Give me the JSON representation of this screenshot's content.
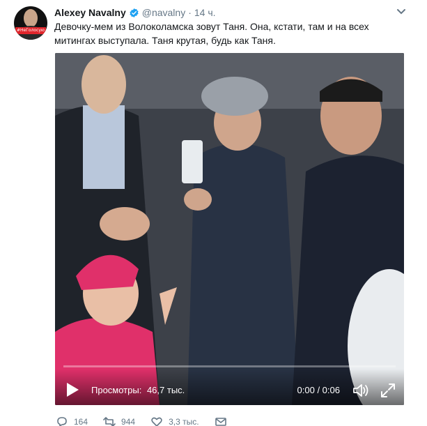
{
  "tweet": {
    "author_name": "Alexey Navalny",
    "author_handle": "@navalny",
    "separator": "·",
    "time": "14 ч.",
    "avatar_tag": "#НеГолосую",
    "text": "Девочку-мем из Волоколамска зовут Таня. Она, кстати, там и на всех митингах выступала. Таня крутая, будь как Таня."
  },
  "video": {
    "views_label": "Просмотры:",
    "views_value": "46,7 тыс.",
    "timecode": "0:00 / 0:06",
    "progress_fraction": 0
  },
  "actions": {
    "replies": "164",
    "retweets": "944",
    "likes": "3,3 тыс."
  },
  "icons": {
    "verified": "verified-badge-icon",
    "caret": "chevron-down-icon",
    "play": "play-icon",
    "volume": "volume-icon",
    "fullscreen": "fullscreen-icon",
    "reply": "reply-icon",
    "retweet": "retweet-icon",
    "like": "heart-icon",
    "message": "envelope-icon"
  },
  "colors": {
    "verified": "#1da1f2",
    "secondary_text": "#657786",
    "primary_text": "#14171a",
    "jacket_pink": "#e0306a"
  }
}
